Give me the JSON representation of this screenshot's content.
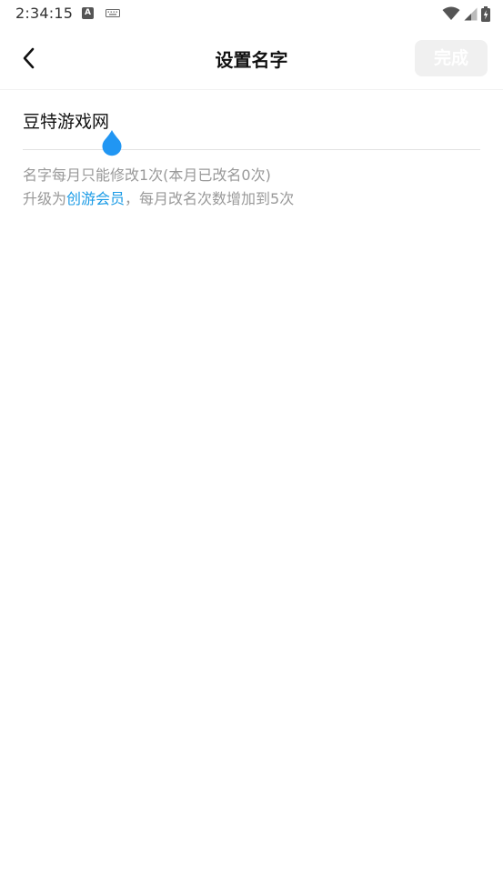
{
  "status_bar": {
    "time": "2:34:15",
    "icons": [
      "accessibility-icon",
      "keyboard-icon",
      "wifi-icon",
      "signal-icon",
      "battery-charging-icon"
    ]
  },
  "header": {
    "back_icon": "chevron-left-icon",
    "title": "设置名字",
    "done_label": "完成"
  },
  "name_field": {
    "value": "豆特游戏网"
  },
  "hints": {
    "limit_text": "名字每月只能修改1次(本月已改名0次)",
    "upgrade_prefix": "升级为",
    "upgrade_link": "创游会员",
    "upgrade_suffix": "，每月改名次数增加到5次"
  },
  "colors": {
    "accent": "#1a9be6",
    "cursor_handle": "#2196f3",
    "done_disabled_bg": "#f0f0f0",
    "hint_text": "#999999"
  }
}
